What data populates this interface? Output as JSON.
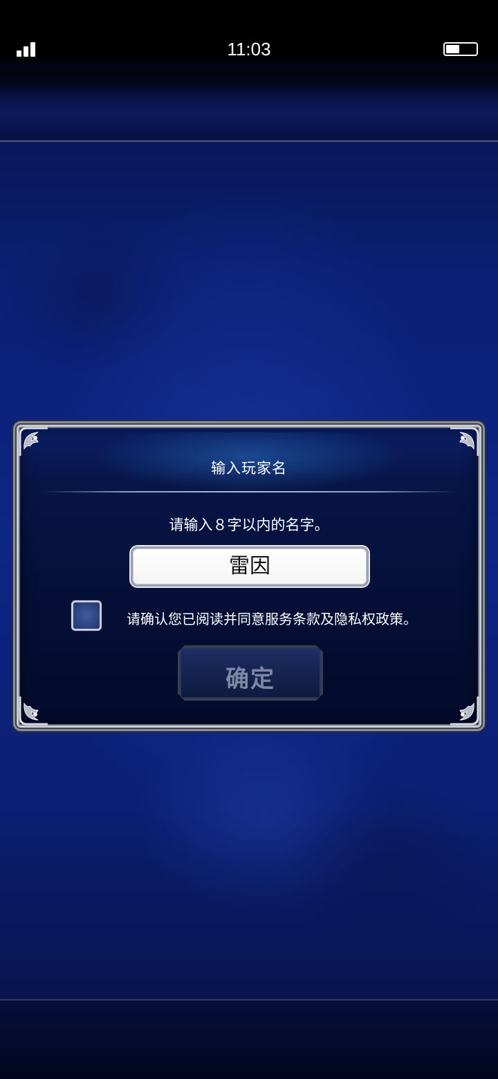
{
  "status_bar": {
    "time": "11:03",
    "signal_icon": "signal-bars-icon",
    "battery_icon": "battery-icon",
    "battery_level": 0.45
  },
  "dialog": {
    "title": "输入玩家名",
    "instruction": "请输入８字以内的名字。",
    "name_value": "雷因",
    "agreement_text": "请确认您已阅读并同意服务条款及隐私权政策。",
    "agreement_checked": false,
    "confirm_label": "确定"
  },
  "colors": {
    "background": "#0d2585",
    "dialog_bg": "#050f36",
    "frame": "#c9ccd3",
    "confirm_text_disabled": "#7e88a3"
  }
}
